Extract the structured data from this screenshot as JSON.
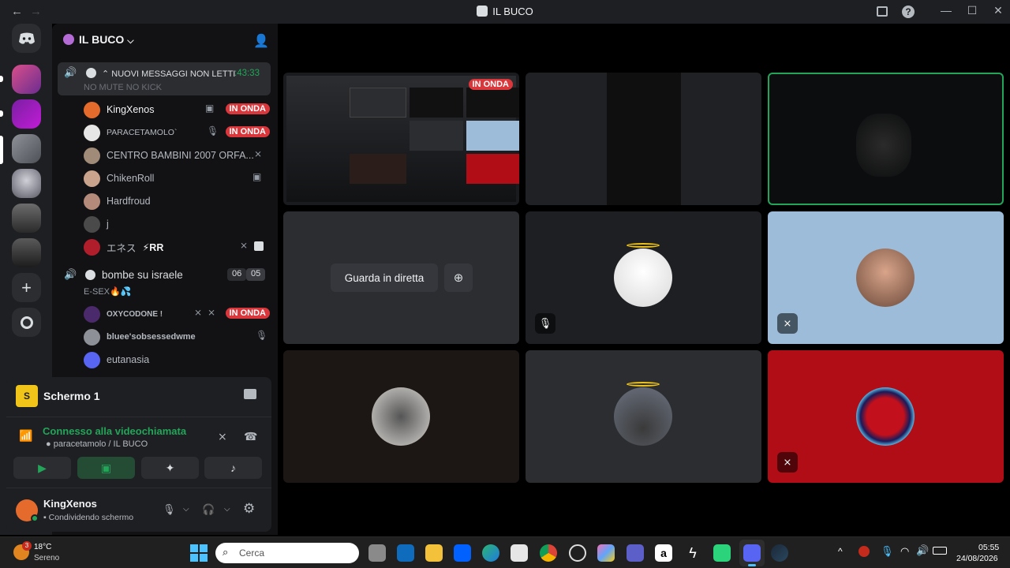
{
  "window": {
    "title": "IL BUCO",
    "back": "←",
    "forward": "→",
    "inbox_icon": "inbox-icon",
    "help_icon": "?",
    "minimize": "—",
    "maximize": "☐",
    "close": "✕"
  },
  "server": {
    "name": "IL BUCO",
    "chevron": "⌵",
    "invite_icon": "add-member-icon"
  },
  "channel1": {
    "banner": "NUOVI MESSAGGI NON LETTI",
    "timer": ":43:33",
    "status": "NO MUTE NO KICK"
  },
  "members1": [
    {
      "name": "KingXenos",
      "badge": "IN ONDA",
      "icon": "▣"
    },
    {
      "name": "PARACETAMOLO`",
      "badge": "IN ONDA",
      "icon": "🎙"
    },
    {
      "name": "CENTRO BAMBINI 2007 ORFA...",
      "icon": "⨯"
    },
    {
      "name": "ChikenRoll",
      "icon": "▣"
    },
    {
      "name": "Hardfroud"
    },
    {
      "name": "j"
    },
    {
      "name": "エネス",
      "extra": "⚡RR"
    }
  ],
  "channel2": {
    "name": "bombe su israele",
    "count_a": "06",
    "count_b": "05",
    "status": "E-SEX🔥💦"
  },
  "members2": [
    {
      "name": "OXYCODONE !",
      "badge": "IN ONDA"
    },
    {
      "name": "bluee'sobsessedwme"
    },
    {
      "name": "eutanasia"
    }
  ],
  "voice": {
    "stream_title": "Schermo 1",
    "connected": "Connesso alla videochiamata",
    "location": "paracetamolo / IL BUCO",
    "user": "KingXenos",
    "user_status": "Condividendo schermo"
  },
  "stage": {
    "live_badge": "IN ONDA",
    "watch_label": "Guarda in diretta"
  },
  "taskbar": {
    "weather_temp": "18°C",
    "weather_desc": "Sereno",
    "weather_badge": "3",
    "search_placeholder": "Cerca",
    "time": "05:55",
    "date": "24/08/2026"
  },
  "colors": {
    "accent_green": "#23a559",
    "live_red": "#da373c",
    "blurple": "#5865f2"
  }
}
